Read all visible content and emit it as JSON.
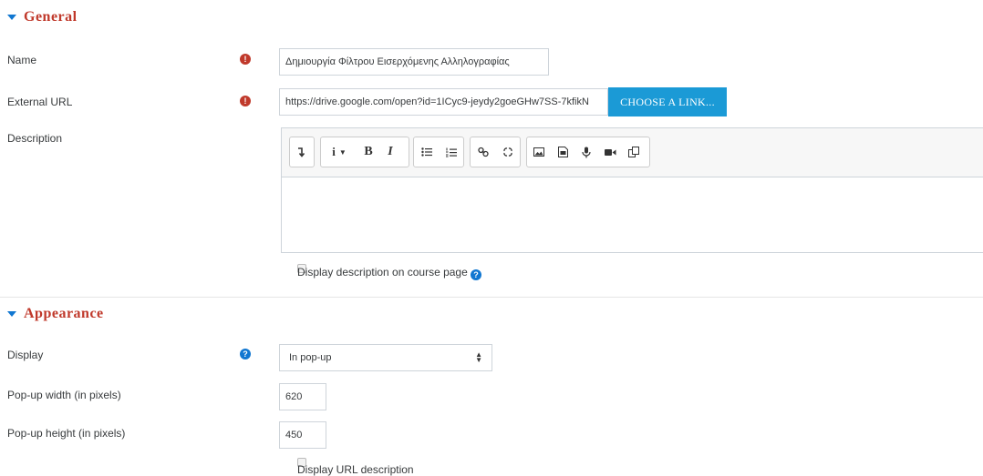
{
  "general": {
    "title": "General",
    "name_label": "Name",
    "name_value": "Δημιουργία Φίλτρου Εισερχόμενης Αλληλογραφίας",
    "url_label": "External URL",
    "url_value": "https://drive.google.com/open?id=1ICyc9-jeydy2goeGHw7SS-7kfikN",
    "choose_link_label": "CHOOSE A LINK...",
    "description_label": "Description",
    "display_description_label": "Display description on course page"
  },
  "editor_toolbar": {
    "buttons": [
      "collapse",
      "info-dropdown",
      "bold",
      "italic",
      "unordered-list",
      "ordered-list",
      "link",
      "unlink",
      "image",
      "media",
      "record-audio",
      "record-video",
      "manage-files"
    ],
    "bold_glyph": "B",
    "italic_glyph": "I",
    "info_glyph": "i"
  },
  "appearance": {
    "title": "Appearance",
    "display_label": "Display",
    "display_value": "In pop-up",
    "popup_width_label": "Pop-up width (in pixels)",
    "popup_width_value": "620",
    "popup_height_label": "Pop-up height (in pixels)",
    "popup_height_value": "450",
    "display_url_description_label": "Display URL description"
  },
  "colors": {
    "section_header": "#c0392b",
    "required_icon": "#c0392b",
    "help_icon": "#1177d1",
    "choose_button": "#1b9ad6"
  },
  "icons": {
    "required": "exclamation-circle-icon",
    "help": "question-circle-icon"
  }
}
